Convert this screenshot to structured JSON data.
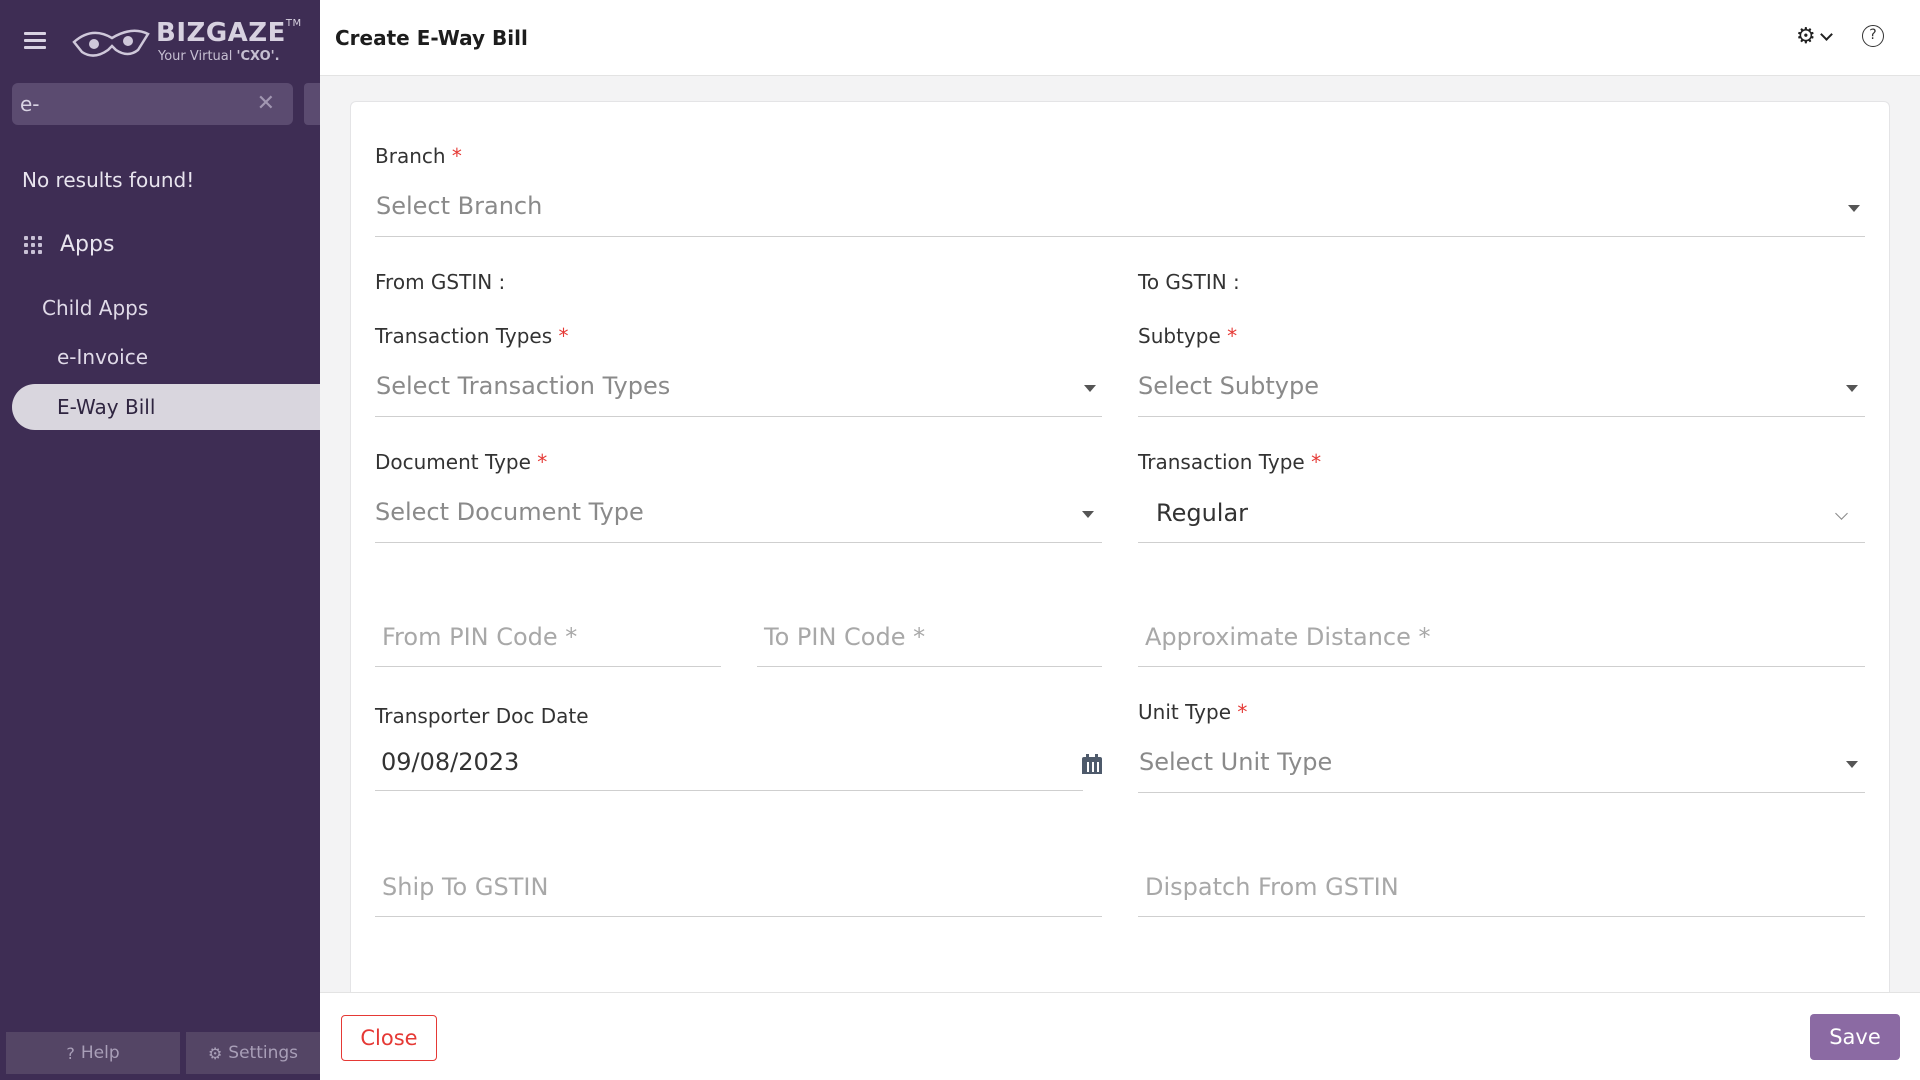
{
  "sidebar": {
    "brand": {
      "name": "BIZGAZE",
      "trademark": "TM",
      "tagline_prefix": "Your Virtual ",
      "tagline_bold": "'CXO'."
    },
    "search": {
      "value": "e-",
      "clear_icon": "close-icon"
    },
    "no_results": "No results found!",
    "apps_label": "Apps",
    "child_apps_label": "Child Apps",
    "items": [
      "e-Invoice",
      "E-Way Bill"
    ],
    "active_item": "E-Way Bill",
    "footer": {
      "help": "Help",
      "settings": "Settings"
    }
  },
  "header": {
    "title": "Create E-Way Bill",
    "help_glyph": "?"
  },
  "form": {
    "branch": {
      "label": "Branch",
      "required": "*",
      "placeholder": "Select Branch"
    },
    "from_gstin": {
      "label": "From GSTIN :"
    },
    "to_gstin": {
      "label": "To GSTIN :"
    },
    "transaction_types": {
      "label": "Transaction Types",
      "required": "*",
      "placeholder": "Select Transaction Types"
    },
    "subtype": {
      "label": "Subtype",
      "required": "*",
      "placeholder": "Select Subtype"
    },
    "document_type": {
      "label": "Document Type",
      "required": "*",
      "placeholder": "Select Document Type"
    },
    "transaction_type": {
      "label": "Transaction Type",
      "required": "*",
      "value": "Regular"
    },
    "from_pin": {
      "placeholder": "From PIN Code *"
    },
    "to_pin": {
      "placeholder": "To PIN Code *"
    },
    "approx_distance": {
      "placeholder": "Approximate Distance *"
    },
    "transporter_doc_date": {
      "label": "Transporter Doc Date",
      "value": "09/08/2023"
    },
    "unit_type": {
      "label": "Unit Type",
      "required": "*",
      "placeholder": "Select Unit Type"
    },
    "ship_to_gstin": {
      "placeholder": "Ship To GSTIN"
    },
    "dispatch_from_gstin": {
      "placeholder": "Dispatch From GSTIN"
    }
  },
  "actions": {
    "close": "Close",
    "save": "Save"
  },
  "colors": {
    "sidebar_bg": "#3e2d54",
    "accent": "#8b6aa3",
    "danger": "#e53935"
  }
}
